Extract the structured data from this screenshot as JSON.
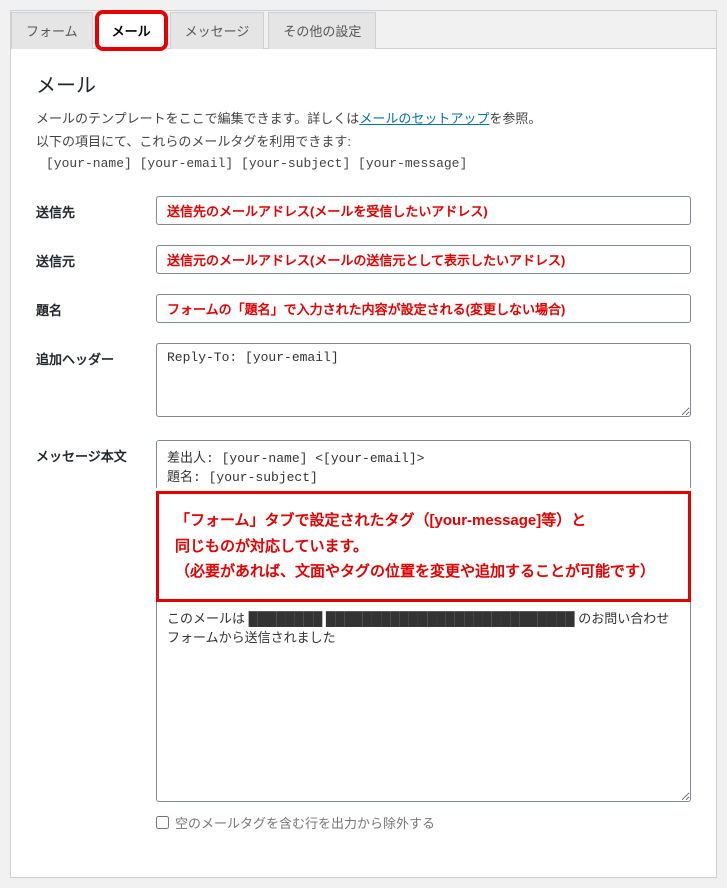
{
  "tabs": {
    "form": "フォーム",
    "mail": "メール",
    "messages": "メッセージ",
    "other": "その他の設定"
  },
  "section": {
    "title": "メール",
    "desc_prefix": "メールのテンプレートをここで編集できます。詳しくは",
    "desc_link": "メールのセットアップ",
    "desc_suffix": "を参照。",
    "tags_intro": "以下の項目にて、これらのメールタグを利用できます:",
    "tags_list": "[your-name] [your-email] [your-subject] [your-message]"
  },
  "fields": {
    "to": {
      "label": "送信先",
      "value": "送信先のメールアドレス(メールを受信したいアドレス)"
    },
    "from": {
      "label": "送信元",
      "value": "送信元のメールアドレス(メールの送信元として表示したいアドレス)"
    },
    "subject": {
      "label": "題名",
      "value": "フォームの「題名」で入力された内容が設定される(変更しない場合)"
    },
    "headers": {
      "label": "追加ヘッダー",
      "value": "Reply-To: [your-email]"
    },
    "body": {
      "label": "メッセージ本文",
      "top": "差出人: [your-name] <[your-email]>\n題名: [your-subject]",
      "bottom": "このメールは ████████ ███████████████████████████ のお問い合わせフォームから送信されました"
    }
  },
  "annotation": {
    "line1": "「フォーム」タブで設定されたタグ（[your-message]等）と",
    "line2": "同じものが対応しています。",
    "line3": "（必要があれば、文面やタグの位置を変更や追加することが可能です）"
  },
  "checkbox": {
    "exclude_empty": "空のメールタグを含む行を出力から除外する"
  }
}
